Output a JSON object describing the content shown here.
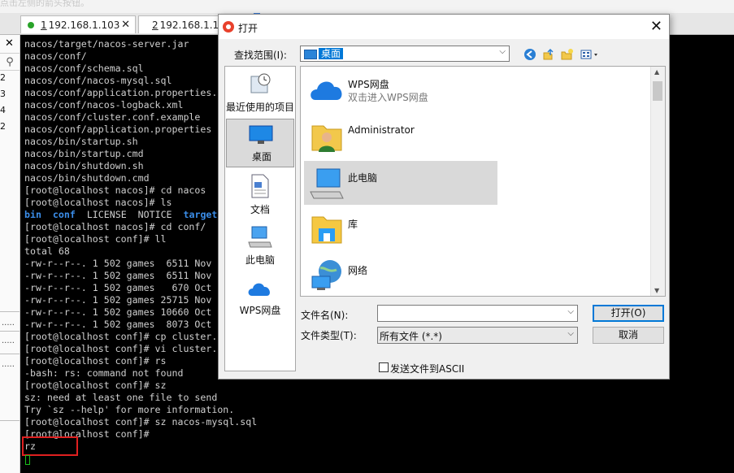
{
  "top_strip_text": "点击左侧的箭头按钮。",
  "tabs": [
    {
      "num": "1",
      "label": "192.168.1.103",
      "close": "✕"
    },
    {
      "num": "2",
      "label": "192.168.1.10"
    }
  ],
  "left_panel": {
    "close": "✕",
    "search_icon": "search-icon",
    "numbers": [
      "2",
      "3",
      "4",
      "2"
    ],
    "dots": "....."
  },
  "terminal": {
    "lines": [
      "nacos/target/nacos-server.jar",
      "nacos/conf/",
      "nacos/conf/schema.sql",
      "nacos/conf/nacos-mysql.sql",
      "nacos/conf/application.properties.",
      "nacos/conf/nacos-logback.xml",
      "nacos/conf/cluster.conf.example",
      "nacos/conf/application.properties",
      "nacos/bin/startup.sh",
      "nacos/bin/startup.cmd",
      "nacos/bin/shutdown.sh",
      "nacos/bin/shutdown.cmd",
      "[root@localhost nacos]# cd nacos",
      "[root@localhost nacos]# ls",
      "",
      "[root@localhost nacos]# cd conf/",
      "[root@localhost conf]# ll",
      "total 68",
      "-rw-r--r--. 1 502 games  6511 Nov",
      "-rw-r--r--. 1 502 games  6511 Nov",
      "-rw-r--r--. 1 502 games   670 Oct",
      "-rw-r--r--. 1 502 games 25715 Nov",
      "-rw-r--r--. 1 502 games 10660 Oct",
      "-rw-r--r--. 1 502 games  8073 Oct",
      "[root@localhost conf]# cp cluster.",
      "[root@localhost conf]# vi cluster.",
      "[root@localhost conf]# rs",
      "-bash: rs: command not found",
      "[root@localhost conf]# sz",
      "sz: need at least one file to send",
      "Try `sz --help' for more information.",
      "[root@localhost conf]# sz nacos-mysql.sql",
      "[root@localhost conf]#",
      "rz"
    ],
    "ls_output": {
      "bin": "bin",
      "conf": "conf",
      "license": "LICENSE",
      "notice": "NOTICE",
      "target": "target"
    }
  },
  "dialog": {
    "title": "打开",
    "close": "✕",
    "look_in_label": "查找范围(I):",
    "look_in_value": "桌面",
    "places": [
      "最近使用的项目",
      "桌面",
      "文档",
      "此电脑",
      "WPS网盘"
    ],
    "files": [
      {
        "name": "WPS网盘",
        "sub": "双击进入WPS网盘"
      },
      {
        "name": "Administrator",
        "sub": ""
      },
      {
        "name": "此电脑",
        "sub": ""
      },
      {
        "name": "库",
        "sub": ""
      },
      {
        "name": "网络",
        "sub": ""
      }
    ],
    "filename_label": "文件名(N):",
    "filename_value": "",
    "filetype_label": "文件类型(T):",
    "filetype_value": "所有文件 (*.*)",
    "open_button": "打开(O)",
    "cancel_button": "取消",
    "ascii_checkbox": "发送文件到ASCII",
    "colors": {
      "selection": "#0078d7",
      "file_selected": "#d9d9d9"
    }
  }
}
